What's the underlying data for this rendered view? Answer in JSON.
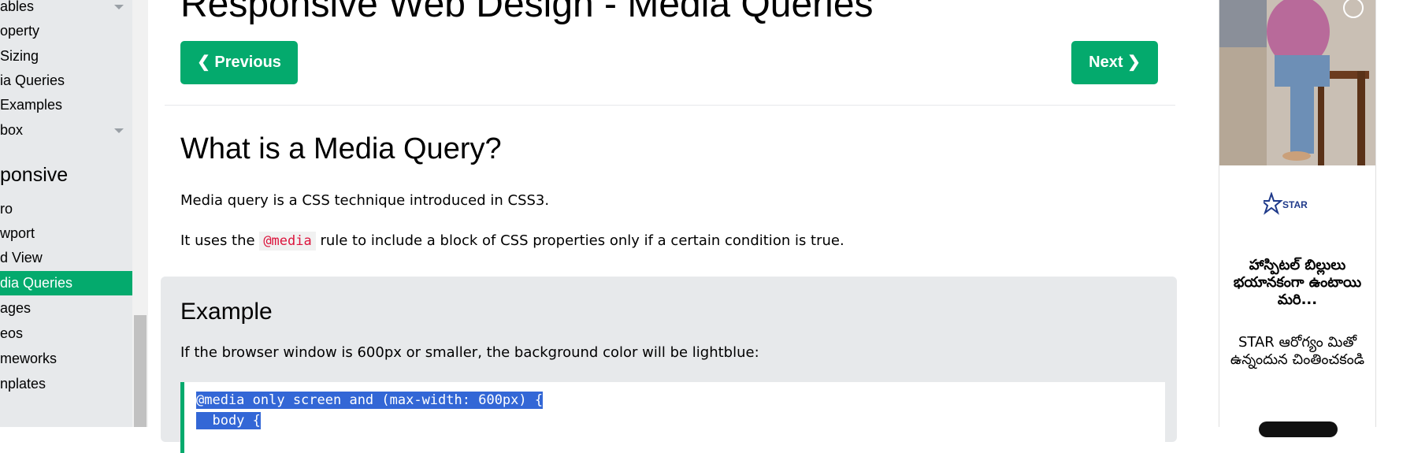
{
  "sidebar": {
    "items": [
      {
        "label": "ables",
        "chevron": true
      },
      {
        "label": "operty",
        "chevron": false
      },
      {
        "label": "Sizing",
        "chevron": false
      },
      {
        "label": "ia Queries",
        "chevron": false
      },
      {
        "label": "Examples",
        "chevron": false
      },
      {
        "label": "box",
        "chevron": true
      }
    ],
    "section_heading": "ponsive",
    "responsive_items": [
      {
        "label": "ro",
        "active": false
      },
      {
        "label": "wport",
        "active": false
      },
      {
        "label": "d View",
        "active": false
      },
      {
        "label": "dia Queries",
        "active": true
      },
      {
        "label": "ages",
        "active": false
      },
      {
        "label": "eos",
        "active": false
      },
      {
        "label": "meworks",
        "active": false
      },
      {
        "label": "nplates",
        "active": false
      }
    ]
  },
  "main": {
    "page_title": "Responsive Web Design - Media Queries",
    "prev_label": "Previous",
    "next_label": "Next",
    "section_title": "What is a Media Query?",
    "para1": "Media query is a CSS technique introduced in CSS3.",
    "para2_before": "It uses the ",
    "para2_code": "@media",
    "para2_after": " rule to include a block of CSS properties only if a certain condition is true.",
    "example": {
      "title": "Example",
      "description": "If the browser window is 600px or smaller, the background color will be lightblue:",
      "code_lines": [
        "@media only screen and (max-width: 600px) {",
        "  body {"
      ]
    }
  },
  "ad": {
    "logo_text": "STAR",
    "headline": "హాస్పిటల్ బిల్లులు భయానకంగా ఉంటాయి మరి...",
    "body": "STAR ఆరోగ్యం మితో ఉన్నందున చింతించకండి"
  },
  "colors": {
    "accent": "#04aa6d",
    "sidebar_bg": "#e7e9eb",
    "code_selection": "#3367d6",
    "inline_code": "#dc143c"
  },
  "icons": [
    "chevron-left-icon",
    "chevron-right-icon",
    "chevron-down-icon",
    "star-logo-icon"
  ]
}
